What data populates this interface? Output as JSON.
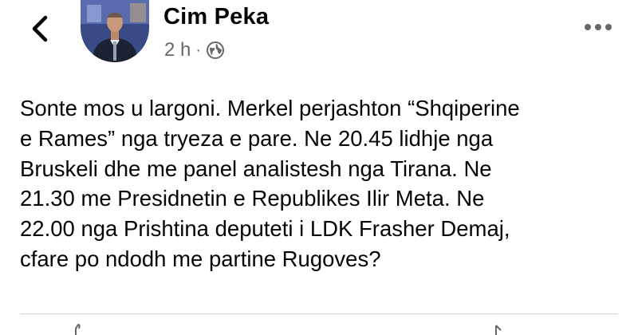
{
  "post": {
    "author": "Cim Peka",
    "time": "2 h",
    "separator": "·",
    "body": "Sonte mos u largoni. Merkel perjashton “Shqiperine\ne Rames” nga tryeza e pare. Ne 20.45 lidhje nga\nBruskeli dhe me panel analistesh nga Tirana. Ne\n21.30 me Presidnetin e Republikes Ilir Meta. Ne\n22.00 nga Prishtina deputeti i LDK  Frasher Demaj,\ncfare po ndodh me partine Rugoves?"
  },
  "icons": {
    "back": "chevron-left-icon",
    "privacy": "globe-icon",
    "more": "more-horizontal-icon"
  }
}
